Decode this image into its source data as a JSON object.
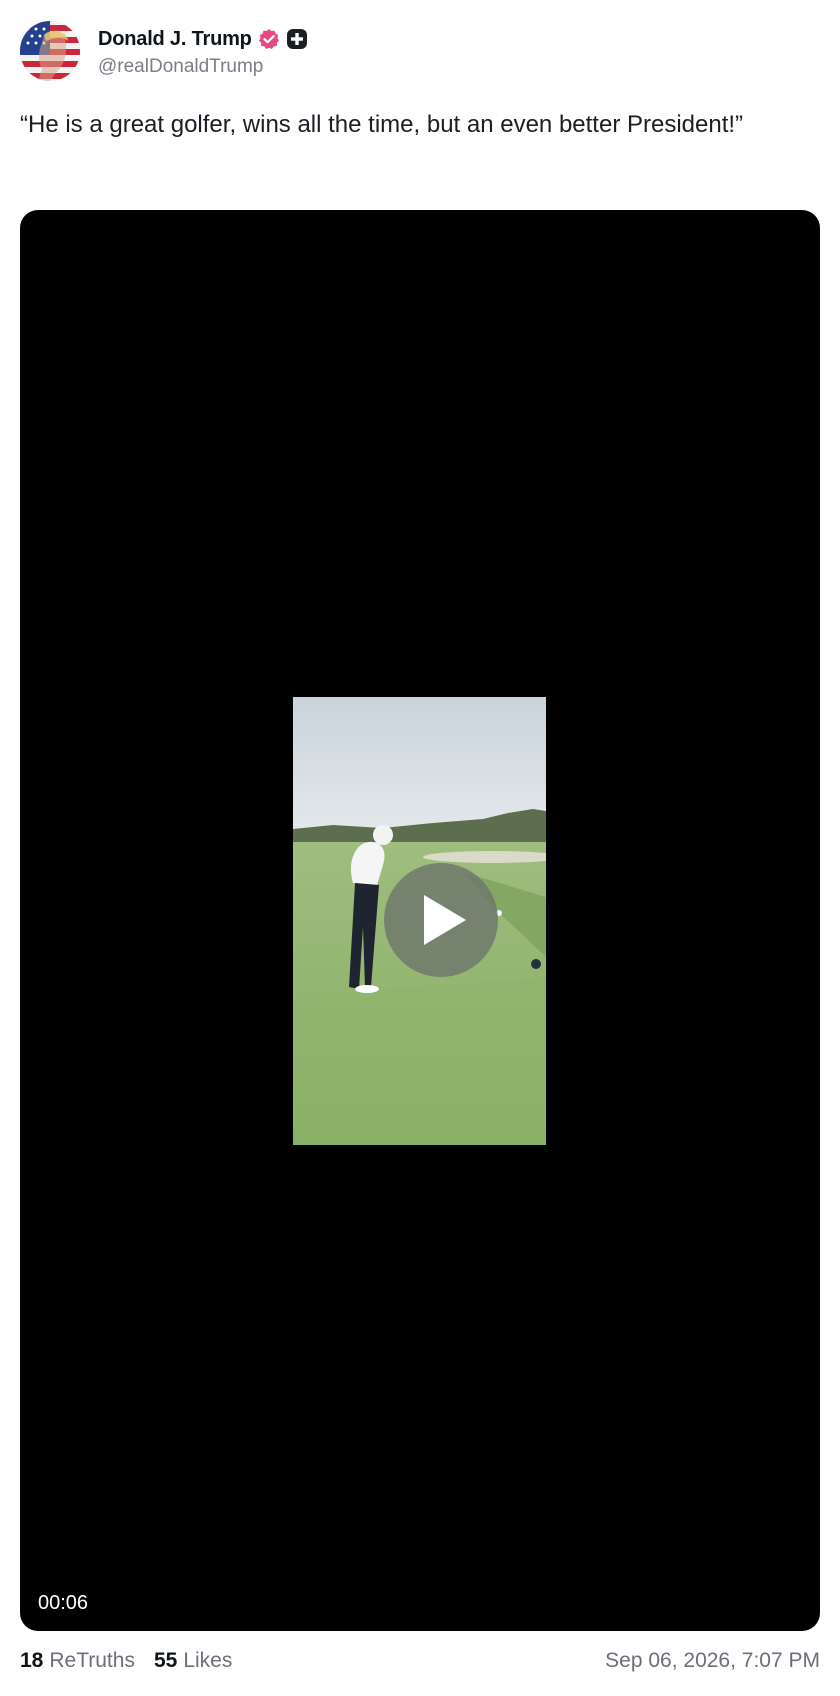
{
  "author": {
    "display_name": "Donald J. Trump",
    "handle": "@realDonaldTrump",
    "avatar_icon": "flag-portrait-avatar",
    "verified_icon": "verified-badge-icon",
    "verified_color": "#e7487d",
    "plus_icon": "plus-badge-icon"
  },
  "post": {
    "text": "“He is a great golfer, wins all the time, but an even better President!”"
  },
  "video": {
    "duration": "00:06",
    "play_icon": "play-icon",
    "background_color": "#000000"
  },
  "stats": {
    "retruths_count": "18",
    "retruths_label": "ReTruths",
    "likes_count": "55",
    "likes_label": "Likes"
  },
  "timestamp": "Sep 06, 2026, 7:07 PM"
}
